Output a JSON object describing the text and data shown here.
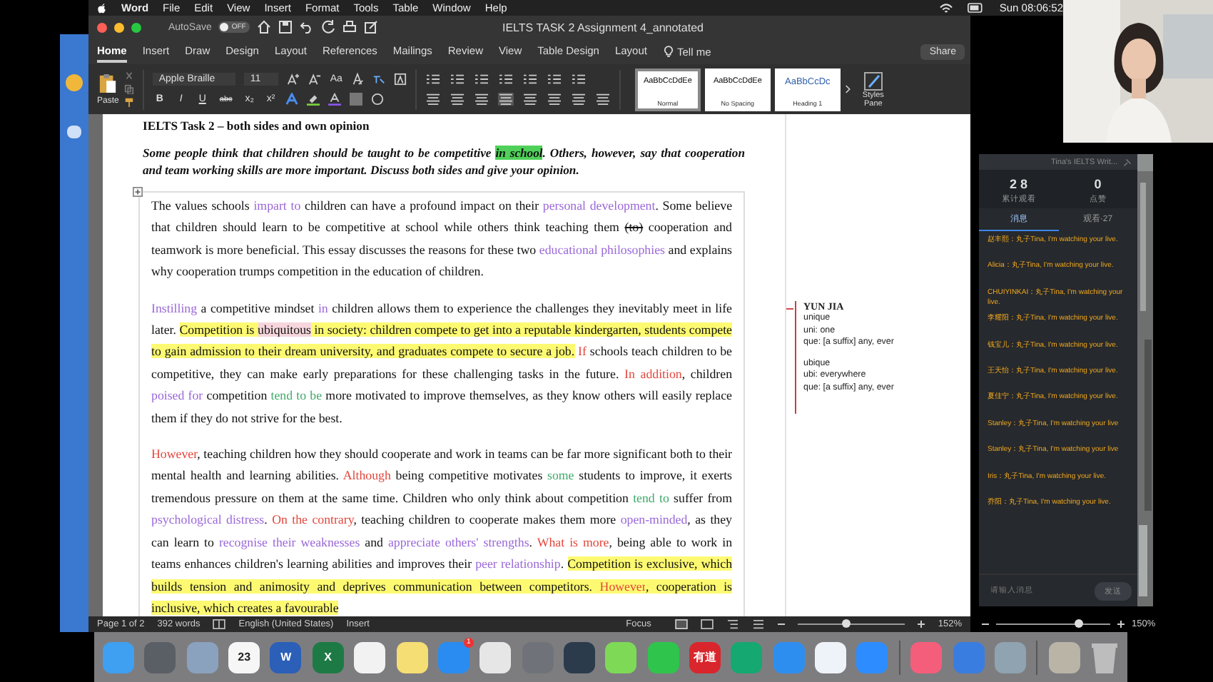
{
  "menu_bar": {
    "app": "Word",
    "items": [
      "File",
      "Edit",
      "View",
      "Insert",
      "Format",
      "Tools",
      "Table",
      "Window",
      "Help"
    ],
    "clock": "Sun 08:06:52"
  },
  "window": {
    "autosave": "AutoSave",
    "autosave_on": false,
    "toggle_label": "OFF",
    "title": "IELTS TASK 2 Assignment 4_annotated"
  },
  "tabs": [
    {
      "label": "Home",
      "selected": true
    },
    {
      "label": "Insert",
      "selected": false
    },
    {
      "label": "Draw",
      "selected": false
    },
    {
      "label": "Design",
      "selected": false
    },
    {
      "label": "Layout",
      "selected": false
    },
    {
      "label": "References",
      "selected": false
    },
    {
      "label": "Mailings",
      "selected": false
    },
    {
      "label": "Review",
      "selected": false
    },
    {
      "label": "View",
      "selected": false
    },
    {
      "label": "Table Design",
      "selected": false
    },
    {
      "label": "Layout",
      "selected": false
    }
  ],
  "tell_me": "Tell me",
  "share": "Share",
  "ribbon": {
    "paste": "Paste",
    "font": "Apple Braille",
    "size": "11",
    "change_case": "Aa",
    "format_buttons": [
      "B",
      "I",
      "U",
      "abc",
      "x₂",
      "x²"
    ],
    "styles": [
      {
        "preview": "AaBbCcDdEe",
        "name": "Normal",
        "selected": true
      },
      {
        "preview": "AaBbCcDdEe",
        "name": "No Spacing",
        "selected": false
      },
      {
        "preview": "AaBbCcDc",
        "name": "Heading 1",
        "selected": false
      }
    ],
    "styles_pane": "Styles Pane"
  },
  "document": {
    "heading": "IELTS Task 2 – both sides and own opinion",
    "prompt": [
      {
        "text": "Some people think that children should be taught to be competitive ",
        "kind": "plain"
      },
      {
        "text": "in school",
        "kind": "green-highlight"
      },
      {
        "text": ". Others, however, say that cooperation and team working skills are more important. Discuss both sides and give your opinion.",
        "kind": "plain"
      }
    ],
    "paragraphs": [
      [
        {
          "text": "The values schools ",
          "kind": "plain"
        },
        {
          "text": "impart to",
          "kind": "vocab"
        },
        {
          "text": " children can have a profound impact on their ",
          "kind": "plain"
        },
        {
          "text": "personal development",
          "kind": "vocab"
        },
        {
          "text": ". Some believe that children should learn to be competitive at school while others think teaching them ",
          "kind": "plain"
        },
        {
          "text": "(to)",
          "kind": "strike"
        },
        {
          "text": " cooperation and teamwork is more beneficial. This essay discusses the reasons for these two ",
          "kind": "plain"
        },
        {
          "text": "educational philosophies",
          "kind": "vocab"
        },
        {
          "text": " and explains why cooperation trumps competition in the education of children.",
          "kind": "plain"
        }
      ],
      [
        {
          "text": "Instilling",
          "kind": "vocab"
        },
        {
          "text": " a competitive mindset ",
          "kind": "plain"
        },
        {
          "text": "in",
          "kind": "vocab"
        },
        {
          "text": " children allows them to experience the challenges they inevitably meet in life later. ",
          "kind": "plain"
        },
        {
          "text": "Competition is ",
          "kind": "highlight"
        },
        {
          "text": "ubiquitous",
          "kind": "mark"
        },
        {
          "text": " in society: children compete to get into a reputable kindergarten, students compete to gain admission to their dream university, and graduates compete to secure a job.",
          "kind": "highlight"
        },
        {
          "text": " If",
          "kind": "linker"
        },
        {
          "text": " schools teach children to be competitive, they can make early preparations for these challenging tasks in the future. ",
          "kind": "plain"
        },
        {
          "text": "In addition",
          "kind": "linker"
        },
        {
          "text": ", children ",
          "kind": "plain"
        },
        {
          "text": "poised for",
          "kind": "vocab"
        },
        {
          "text": " competition ",
          "kind": "plain"
        },
        {
          "text": "tend to be",
          "kind": "hedge"
        },
        {
          "text": " more motivated to improve themselves, as they know others will easily replace them if they do not strive for the best.",
          "kind": "plain"
        }
      ],
      [
        {
          "text": "However",
          "kind": "linker"
        },
        {
          "text": ", teaching children how they should cooperate and work in teams can be far more significant both to their mental health and learning abilities. ",
          "kind": "plain"
        },
        {
          "text": "Although",
          "kind": "linker"
        },
        {
          "text": " being competitive motivates ",
          "kind": "plain"
        },
        {
          "text": "some",
          "kind": "hedge"
        },
        {
          "text": " students to improve, it exerts tremendous pressure on them at the same time. Children who only think about competition ",
          "kind": "plain"
        },
        {
          "text": "tend to",
          "kind": "hedge"
        },
        {
          "text": " suffer from ",
          "kind": "plain"
        },
        {
          "text": "psychological distress",
          "kind": "vocab"
        },
        {
          "text": ". ",
          "kind": "plain"
        },
        {
          "text": "On the contrary",
          "kind": "linker"
        },
        {
          "text": ", teaching children to cooperate makes them more ",
          "kind": "plain"
        },
        {
          "text": "open-minded",
          "kind": "vocab"
        },
        {
          "text": ", as they can learn to ",
          "kind": "plain"
        },
        {
          "text": "recognise their weaknesses",
          "kind": "vocab"
        },
        {
          "text": " and ",
          "kind": "plain"
        },
        {
          "text": "appreciate others' strengths",
          "kind": "vocab"
        },
        {
          "text": ". ",
          "kind": "plain"
        },
        {
          "text": "What is more",
          "kind": "linker"
        },
        {
          "text": ", being able to work in teams enhances children's learning abilities and improves their ",
          "kind": "plain"
        },
        {
          "text": "peer relationship",
          "kind": "vocab"
        },
        {
          "text": ". ",
          "kind": "plain"
        },
        {
          "text": "Competition is exclusive, which builds tension and animosity and deprives communication between competitors. ",
          "kind": "highlight"
        },
        {
          "text": "However",
          "kind": "highlight-linker"
        },
        {
          "text": ", cooperation is inclusive, which creates a favourable",
          "kind": "highlight"
        }
      ]
    ]
  },
  "comment": {
    "author": "YUN JIA",
    "lines": [
      "unique",
      "uni: one",
      "que: [a suffix] any, ever",
      "ubique",
      "ubi: everywhere",
      "que: [a suffix] any, ever"
    ]
  },
  "status_bar": {
    "page": "Page 1 of 2",
    "words": "392 words",
    "language": "English (United States)",
    "mode": "Insert",
    "focus": "Focus",
    "zoom": "152%",
    "level": 0.45
  },
  "back_window": {
    "zoom": "150%",
    "level": 0.72
  },
  "chat": {
    "title": "Tina's IELTS Writ...",
    "stats": [
      {
        "value": "2 8",
        "label": "累计观看"
      },
      {
        "value": "0",
        "label": "点赞"
      }
    ],
    "tabs": [
      {
        "label": "消息",
        "selected": true
      },
      {
        "label": "观看·27",
        "selected": false
      }
    ],
    "messages": [
      "赵丰熙：丸子Tina, I'm watching your live.",
      "Alicia：丸子Tina, I'm watching your live.",
      "CHUIYINKAI：丸子Tina, I'm watching your live.",
      "李耀阳：丸子Tina, I'm watching your live.",
      "钱宝儿：丸子Tina, I'm watching your live.",
      "王天怡：丸子Tina, I'm watching your live.",
      "夏佳宁：丸子Tina, I'm watching your live.",
      "Stanley：丸子Tina, I'm watching your live",
      "Stanley：丸子Tina, I'm watching your live",
      "Iris：丸子Tina, I'm watching your live.",
      "乔阳：丸子Tina, I'm watching your live."
    ],
    "placeholder": "请输入消息",
    "send": "发送"
  },
  "dock": [
    {
      "kind": "app",
      "color": "#3f9ff0"
    },
    {
      "kind": "app",
      "color": "#5a5f66"
    },
    {
      "kind": "app",
      "color": "#8aa2bd"
    },
    {
      "kind": "app",
      "color": "#f6f6f6",
      "label": "23"
    },
    {
      "kind": "app",
      "color": "#2b5fb8",
      "label": "W"
    },
    {
      "kind": "app",
      "color": "#1e7a45",
      "label": "X"
    },
    {
      "kind": "app",
      "color": "#f2f2f2"
    },
    {
      "kind": "app",
      "color": "#f5de74"
    },
    {
      "kind": "app",
      "color": "#2a8cf0",
      "badge": "1"
    },
    {
      "kind": "app",
      "color": "#e6e6e6"
    },
    {
      "kind": "app",
      "color": "#6f7379"
    },
    {
      "kind": "app",
      "color": "#2b3b4c"
    },
    {
      "kind": "app",
      "color": "#7ed957"
    },
    {
      "kind": "app",
      "color": "#2fc44c"
    },
    {
      "kind": "app",
      "color": "#d8262c",
      "label": "有道"
    },
    {
      "kind": "app",
      "color": "#15a870"
    },
    {
      "kind": "app",
      "color": "#2e8ef0"
    },
    {
      "kind": "app",
      "color": "#eef3fa"
    },
    {
      "kind": "app",
      "color": "#2d8cff"
    },
    {
      "kind": "divider"
    },
    {
      "kind": "app",
      "color": "#f55e7a"
    },
    {
      "kind": "app",
      "color": "#3a7de0"
    },
    {
      "kind": "app",
      "color": "#8fa3b0"
    },
    {
      "kind": "divider"
    },
    {
      "kind": "app",
      "color": "#b9b4a6"
    },
    {
      "kind": "trash",
      "color": "#bdbdbd"
    }
  ]
}
